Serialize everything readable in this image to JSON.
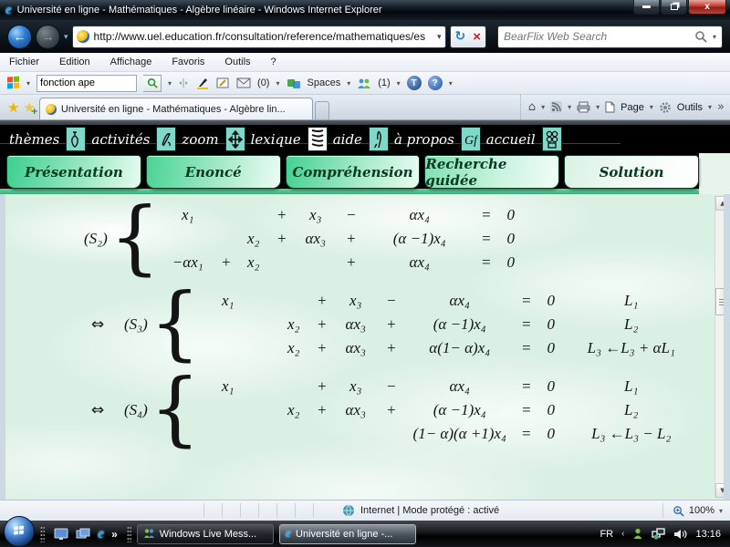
{
  "window": {
    "title": "Université en ligne - Mathématiques - Algèbre linéaire - Windows Internet Explorer"
  },
  "address_bar": {
    "url": "http://www.uel.education.fr/consultation/reference/mathematiques/es",
    "search_placeholder": "BearFlix Web Search"
  },
  "menu_bar": {
    "items": [
      "Fichier",
      "Edition",
      "Affichage",
      "Favoris",
      "Outils",
      "?"
    ]
  },
  "live_toolbar": {
    "search_value": "fonction ape",
    "mail_count": "(0)",
    "spaces_label": "Spaces",
    "contacts_count": "(1)"
  },
  "tab_bar": {
    "active_tab": "Université en ligne - Mathématiques - Algèbre lin...",
    "page_label": "Page",
    "tools_label": "Outils",
    "overflow": "»"
  },
  "site_nav": {
    "items": [
      "thèmes",
      "activités",
      "zoom",
      "lexique",
      "aide",
      "à propos",
      "accueil"
    ]
  },
  "site_tabs": {
    "buttons": [
      "Présentation",
      "Enoncé",
      "Compréhension",
      "Recherche guidée",
      "Solution"
    ],
    "active": "Solution"
  },
  "math": {
    "systems": [
      {
        "arrow": "",
        "label": "(S₂)",
        "rows": [
          [
            "x₁",
            "",
            "",
            "+",
            "x₃",
            "−",
            "αx₄",
            "=",
            "0",
            ""
          ],
          [
            "",
            "",
            "x₂",
            "+",
            "αx₃",
            "+",
            "(α −1)x₄",
            "=",
            "0",
            ""
          ],
          [
            "−αx₁",
            "+",
            "x₂",
            "",
            "",
            "+",
            "αx₄",
            "=",
            "0",
            ""
          ]
        ]
      },
      {
        "arrow": "⇔",
        "label": "(S₃)",
        "rows": [
          [
            "x₁",
            "",
            "",
            "+",
            "x₃",
            "−",
            "αx₄",
            "=",
            "0",
            "L₁"
          ],
          [
            "",
            "",
            "x₂",
            "+",
            "αx₃",
            "+",
            "(α −1)x₄",
            "=",
            "0",
            "L₂"
          ],
          [
            "",
            "",
            "x₂",
            "+",
            "αx₃",
            "+",
            "α(1− α)x₄",
            "=",
            "0",
            "L₃ ←L₃ + αL₁"
          ]
        ]
      },
      {
        "arrow": "⇔",
        "label": "(S₄)",
        "rows": [
          [
            "x₁",
            "",
            "",
            "+",
            "x₃",
            "−",
            "αx₄",
            "=",
            "0",
            "L₁"
          ],
          [
            "",
            "",
            "x₂",
            "+",
            "αx₃",
            "+",
            "(α −1)x₄",
            "=",
            "0",
            "L₂"
          ],
          [
            "",
            "",
            "",
            "",
            "",
            "",
            "(1− α)(α +1)x₄",
            "=",
            "0",
            "L₃ ←L₃ − L₂"
          ]
        ]
      }
    ]
  },
  "status_bar": {
    "zone_text": "Internet | Mode protégé : activé",
    "zoom_level": "100%"
  },
  "taskbar": {
    "tasks": [
      "Windows Live Mess...",
      "Université en ligne -..."
    ],
    "tray": {
      "language": "FR",
      "time": "13:16"
    }
  },
  "colors": {
    "accent_teal": "#7fd8c8",
    "button_green": "#3ecf8e",
    "nav_red_line": "#b01010",
    "close_red": "#c0392b"
  }
}
